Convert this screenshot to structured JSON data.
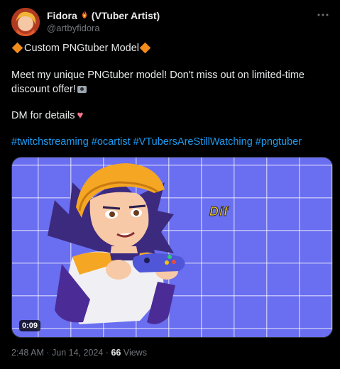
{
  "author": {
    "name": "Fidora",
    "badge": "(VTuber Artist)",
    "handle": "@artbyfidora",
    "avatar_icon": "avatar-image",
    "name_emoji_icon": "fire-heart-icon"
  },
  "tweet": {
    "title": "Custom PNGtuber Model",
    "line2": "Meet my unique PNGtuber model! Don't miss out on  limited-time",
    "line3": "discount offer!",
    "line4": "DM for details",
    "hashtags": [
      "#twitchstreaming",
      "#ocartist",
      "#VTubersAreStillWatching",
      "#pngtuber"
    ]
  },
  "media": {
    "caption": "Dif",
    "duration": "0:09",
    "background_color": "#6a6ef0"
  },
  "meta": {
    "time": "2:48 AM",
    "sep1": "·",
    "date": "Jun 14, 2024",
    "sep2": "·",
    "views_count": "66",
    "views_label": "Views"
  },
  "colors": {
    "background": "#000000",
    "text": "#e7e9ea",
    "muted": "#71767b",
    "link": "#1d9bf0",
    "accent": "#f28c1b"
  }
}
